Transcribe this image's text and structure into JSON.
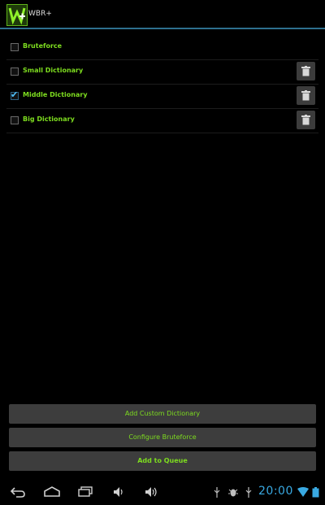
{
  "app": {
    "title": "WBR+"
  },
  "options": [
    {
      "label": "Bruteforce",
      "checked": false,
      "deletable": false
    },
    {
      "label": "Small Dictionary",
      "checked": false,
      "deletable": true
    },
    {
      "label": "Middle Dictionary",
      "checked": true,
      "deletable": true
    },
    {
      "label": "Big Dictionary",
      "checked": false,
      "deletable": true
    }
  ],
  "buttons": {
    "add_custom": "Add Custom Dictionary",
    "configure": "Configure Bruteforce",
    "queue": "Add to Queue"
  },
  "status": {
    "clock": "20:00"
  },
  "colors": {
    "accent_green": "#7ddc1f",
    "accent_blue": "#39a9e2",
    "button_bg": "#3d3d3d"
  },
  "icons": {
    "nav": [
      "back-icon",
      "home-icon",
      "recent-apps-icon",
      "volume-down-icon",
      "volume-up-icon"
    ],
    "status": [
      "usb-icon",
      "debug-icon",
      "usb-icon",
      "wifi-icon",
      "battery-icon"
    ]
  }
}
